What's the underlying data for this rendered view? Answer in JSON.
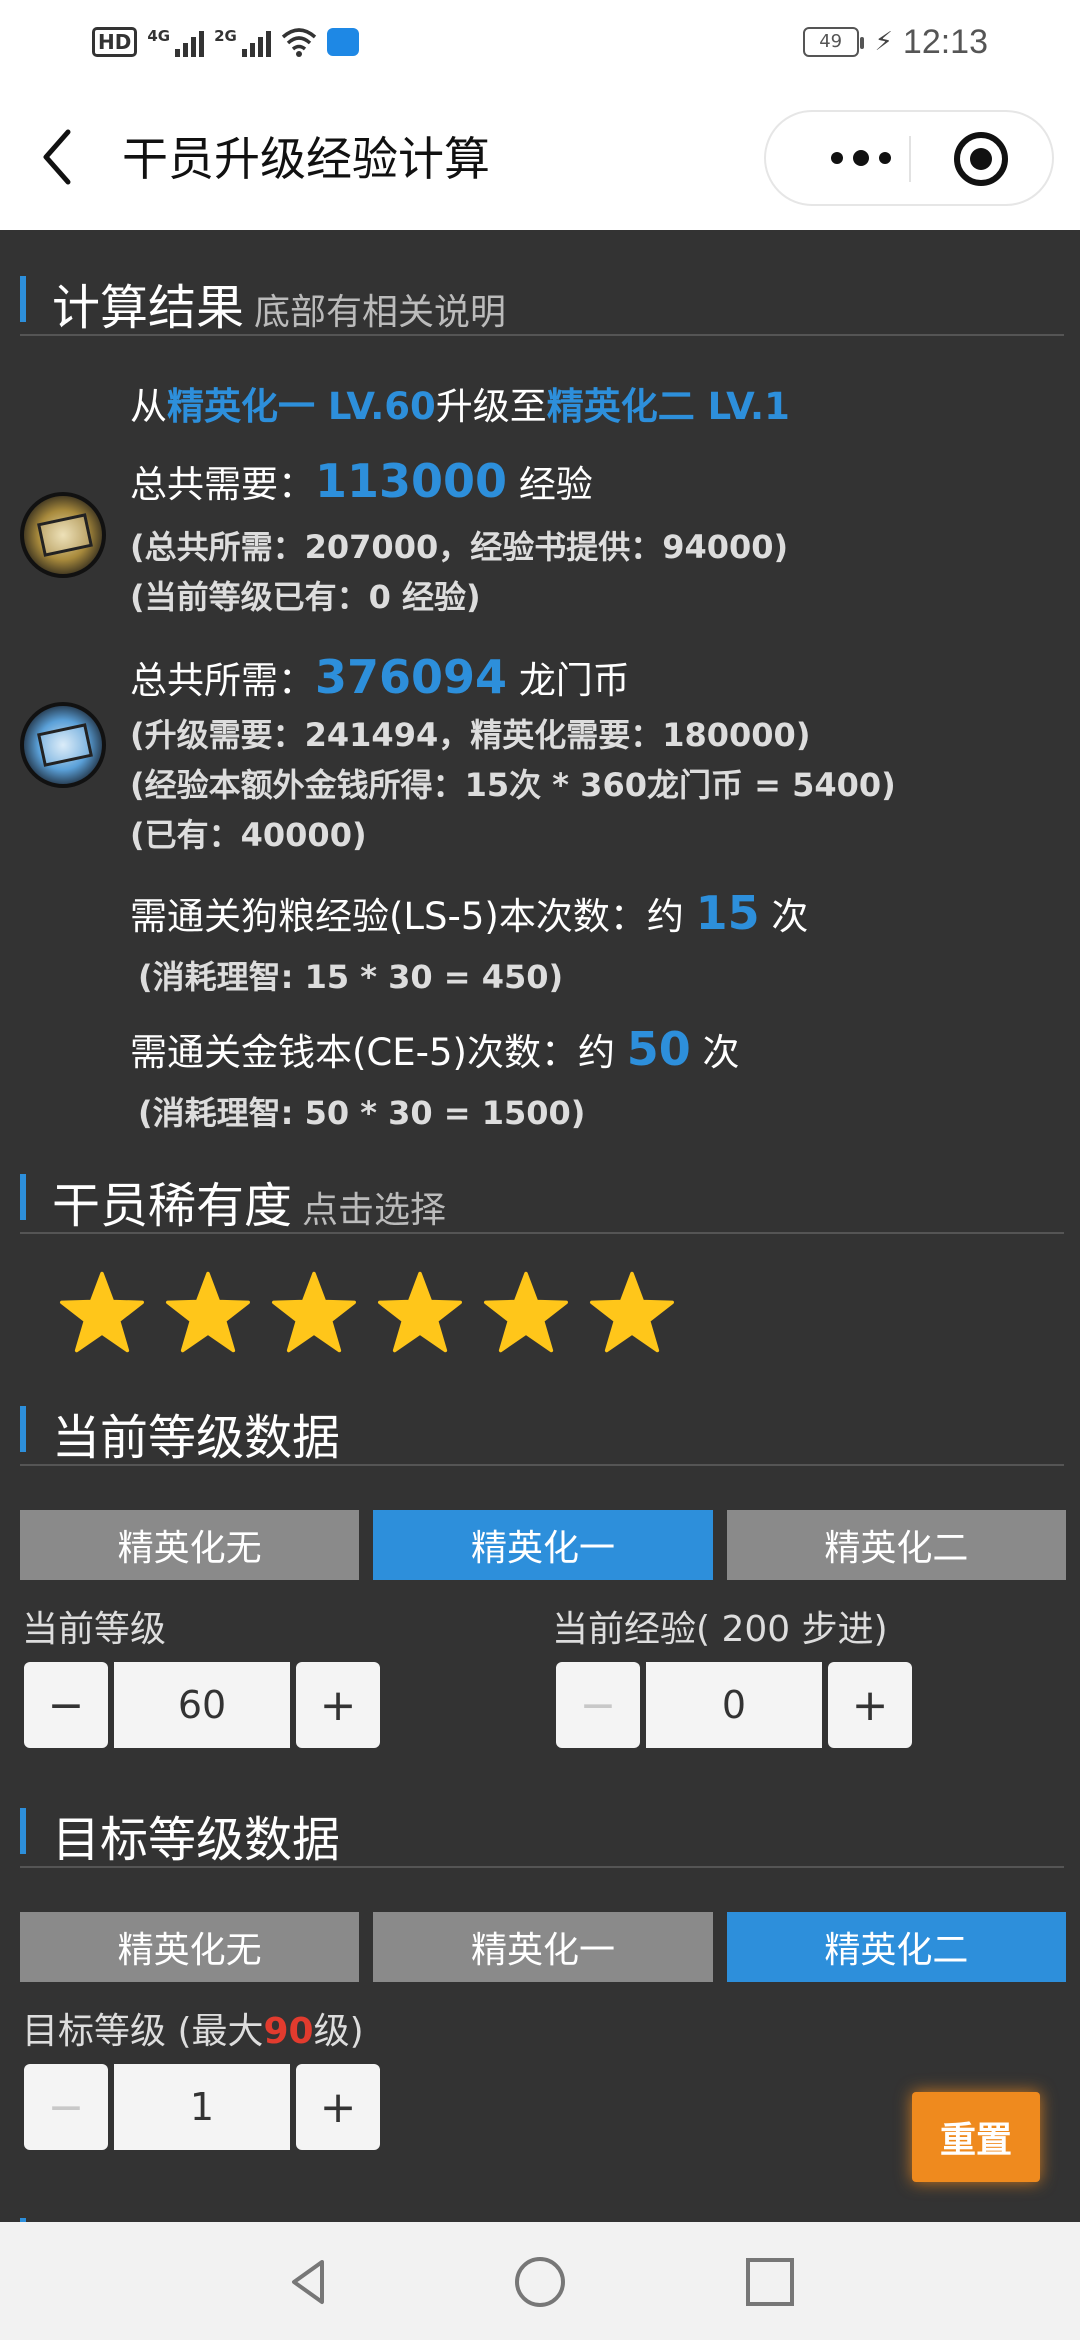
{
  "status_bar": {
    "hd_label": "HD",
    "net1": "4G",
    "net2": "2G",
    "battery": "49",
    "time": "12:13"
  },
  "header": {
    "title": "干员升级经验计算"
  },
  "result": {
    "title": "计算结果",
    "subtitle": "底部有相关说明",
    "from_prefix": "从",
    "from_stage": "精英化一 LV.60",
    "to_middle": "升级至",
    "to_stage": "精英化二 LV.1",
    "exp_total_label": "总共需要：",
    "exp_total_value": "113000",
    "exp_unit": "经验",
    "exp_detail": "(总共所需：207000，经验书提供：94000)",
    "exp_have": "(当前等级已有：0 经验)",
    "money_label": "总共所需：",
    "money_value": "376094",
    "money_unit": "龙门币",
    "money_detail1": "(升级需要：241494，精英化需要：180000)",
    "money_detail2": "(经验本额外金钱所得：15次 * 360龙门币 = 5400)",
    "money_have": "(已有：40000)",
    "ls_label": "需通关狗粮经验(LS-5)本次数：约",
    "ls_value": "15",
    "ls_unit": "次",
    "ls_cost": "(消耗理智: 15 * 30 = 450)",
    "ce_label": "需通关金钱本(CE-5)次数：约",
    "ce_value": "50",
    "ce_unit": "次",
    "ce_cost": "(消耗理智: 50 * 30 = 1500)"
  },
  "rarity": {
    "title": "干员稀有度",
    "subtitle": "点击选择",
    "stars": 6,
    "star_color": "#ffc61a"
  },
  "current": {
    "title": "当前等级数据",
    "tabs": [
      "精英化无",
      "精英化一",
      "精英化二"
    ],
    "active_tab": 1,
    "level_label": "当前等级",
    "level_value": "60",
    "exp_label": "当前经验( 200 步进)",
    "exp_value": "0",
    "minus": "−",
    "plus": "+"
  },
  "target": {
    "title": "目标等级数据",
    "tabs": [
      "精英化无",
      "精英化一",
      "精英化二"
    ],
    "active_tab": 2,
    "level_label_pre": "目标等级 (最大",
    "level_max": "90",
    "level_label_post": "级)",
    "level_value": "1"
  },
  "reset_label": "重置",
  "colors": {
    "accent": "#2d8fdb",
    "background": "#333333",
    "reset": "#ef8a1e",
    "max_level": "#e23b2e"
  }
}
